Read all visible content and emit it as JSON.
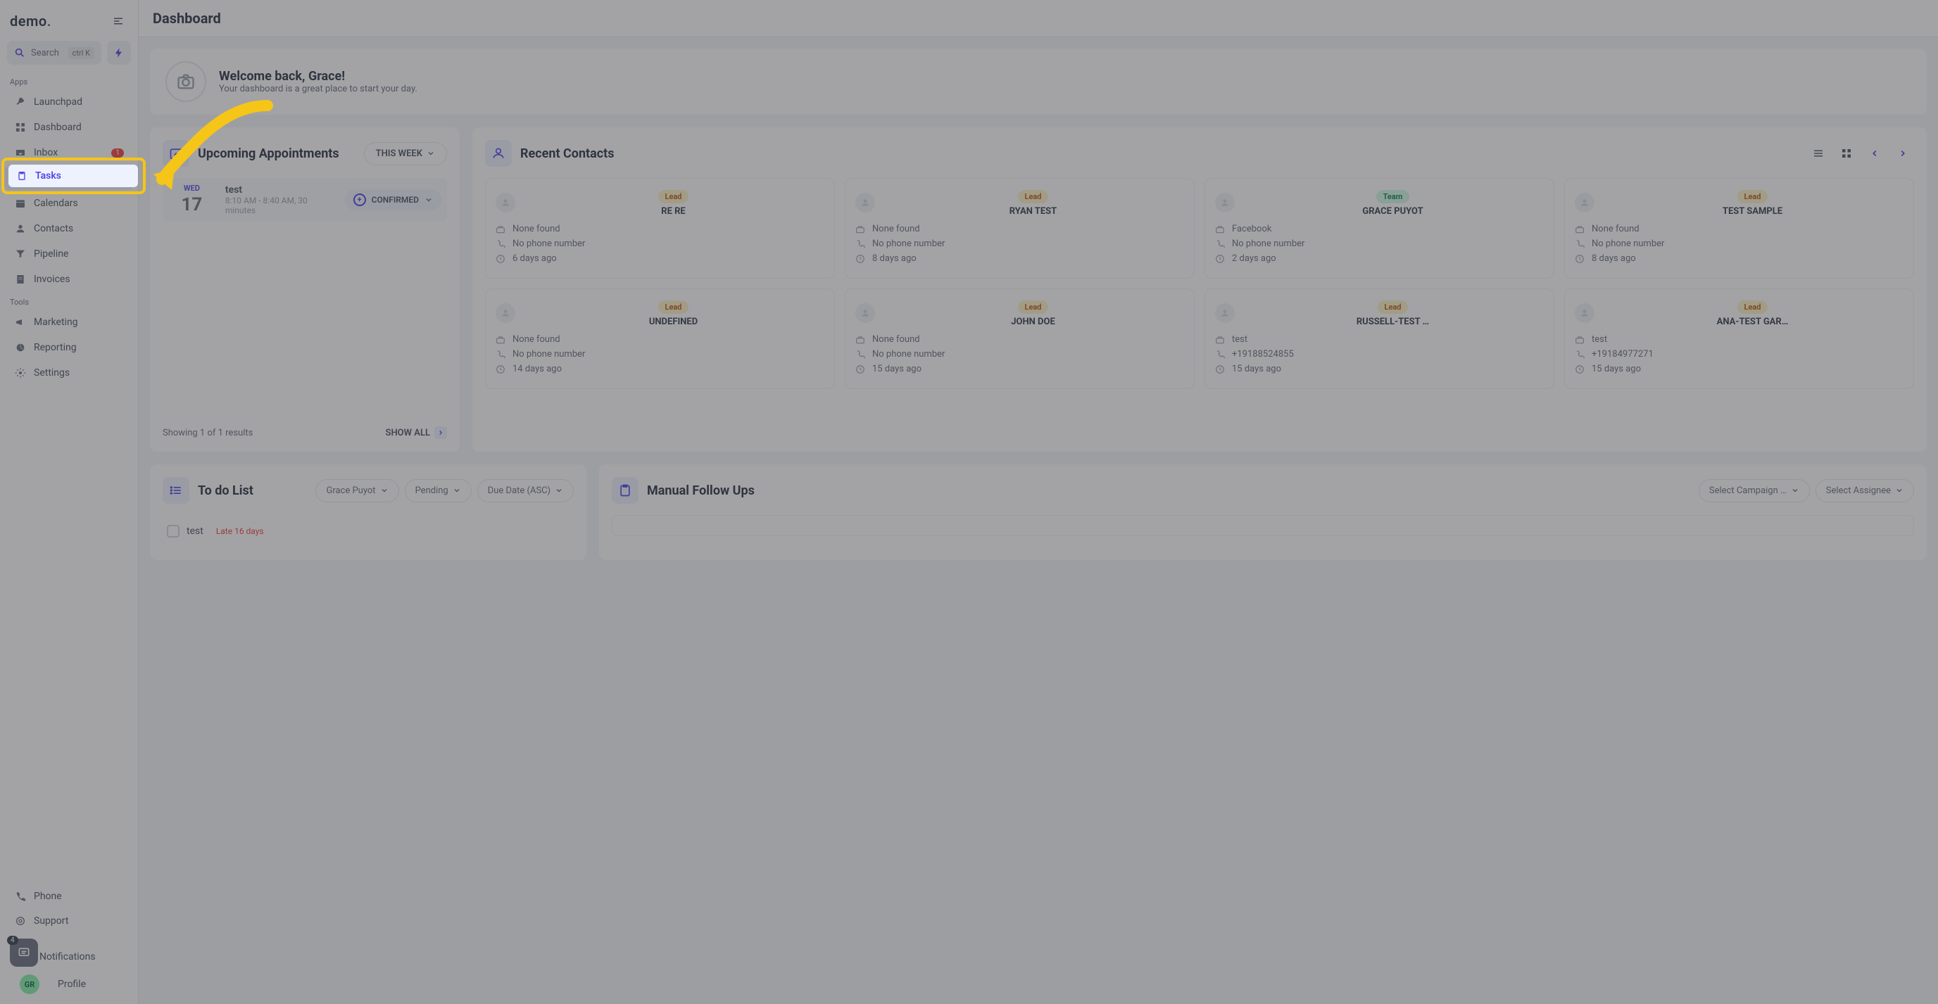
{
  "logo": "demo",
  "search": {
    "label": "Search",
    "shortcut": "ctrl K"
  },
  "sections": {
    "apps": "Apps",
    "tools": "Tools"
  },
  "nav": {
    "launchpad": "Launchpad",
    "dashboard": "Dashboard",
    "inbox": "Inbox",
    "inbox_badge": "1",
    "tasks": "Tasks",
    "calendars": "Calendars",
    "contacts": "Contacts",
    "pipeline": "Pipeline",
    "invoices": "Invoices",
    "marketing": "Marketing",
    "reporting": "Reporting",
    "settings": "Settings",
    "phone": "Phone",
    "support": "Support",
    "notifications": "Notifications",
    "profile": "Profile"
  },
  "chat_badge": "4",
  "avatar_initials": "GR",
  "page_title": "Dashboard",
  "welcome": {
    "title": "Welcome back, Grace!",
    "subtitle": "Your dashboard is a great place to start your day."
  },
  "appointments": {
    "title": "Upcoming Appointments",
    "filter": "THIS WEEK",
    "item": {
      "dow": "WED",
      "day": "17",
      "title": "test",
      "time": "8:10 AM - 8:40 AM, 30 minutes",
      "status": "CONFIRMED"
    },
    "results_text": "Showing 1 of 1 results",
    "show_all": "SHOW ALL"
  },
  "recent_contacts": {
    "title": "Recent Contacts",
    "items": [
      {
        "tag": "Lead",
        "tag_type": "lead",
        "name": "RE RE",
        "company": "None found",
        "phone": "No phone number",
        "time": "6 days ago"
      },
      {
        "tag": "Lead",
        "tag_type": "lead",
        "name": "RYAN TEST",
        "company": "None found",
        "phone": "No phone number",
        "time": "8 days ago"
      },
      {
        "tag": "Team",
        "tag_type": "team",
        "name": "GRACE PUYOT",
        "company": "Facebook",
        "phone": "No phone number",
        "time": "2 days ago"
      },
      {
        "tag": "Lead",
        "tag_type": "lead",
        "name": "TEST SAMPLE",
        "company": "None found",
        "phone": "No phone number",
        "time": "8 days ago"
      },
      {
        "tag": "Lead",
        "tag_type": "lead",
        "name": "UNDEFINED",
        "company": "None found",
        "phone": "No phone number",
        "time": "14 days ago"
      },
      {
        "tag": "Lead",
        "tag_type": "lead",
        "name": "JOHN DOE",
        "company": "None found",
        "phone": "No phone number",
        "time": "15 days ago"
      },
      {
        "tag": "Lead",
        "tag_type": "lead",
        "name": "RUSSELL-TEST …",
        "company": "test",
        "phone": "+19188524855",
        "time": "15 days ago"
      },
      {
        "tag": "Lead",
        "tag_type": "lead",
        "name": "ANA-TEST GAR…",
        "company": "test",
        "phone": "+19184977271",
        "time": "15 days ago"
      }
    ]
  },
  "todo": {
    "title": "To do List",
    "filters": {
      "assignee": "Grace Puyot",
      "status": "Pending",
      "sort": "Due Date (ASC)"
    },
    "item": {
      "title": "test",
      "late": "Late 16 days"
    }
  },
  "followups": {
    "title": "Manual Follow Ups",
    "campaign": "Select Campaign …",
    "assignee": "Select Assignee"
  }
}
